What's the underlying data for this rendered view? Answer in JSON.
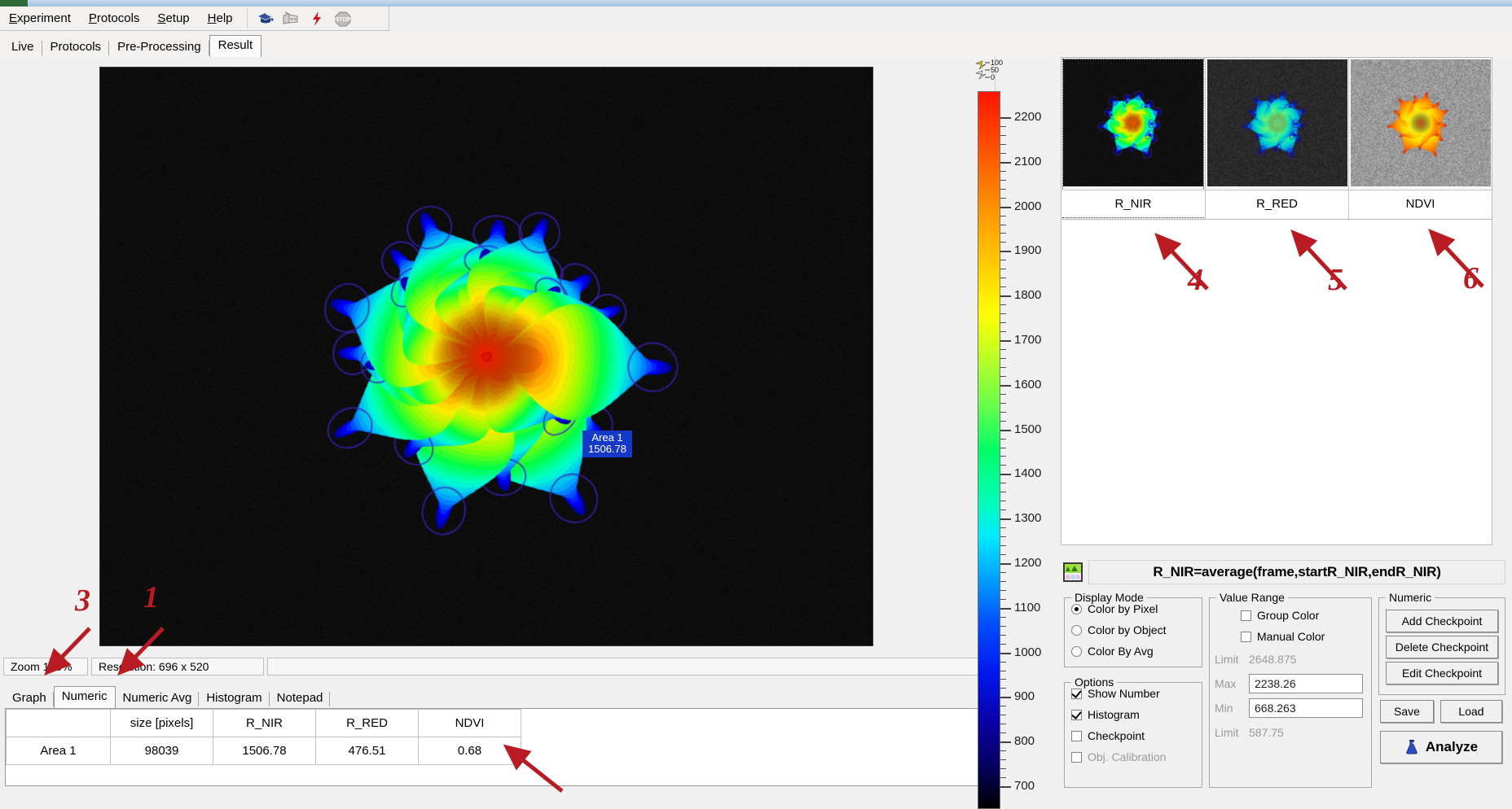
{
  "app": {
    "menu": [
      {
        "label": "Experiment",
        "accel": "E"
      },
      {
        "label": "Protocols",
        "accel": "P"
      },
      {
        "label": "Setup",
        "accel": "S"
      },
      {
        "label": "Help",
        "accel": "H"
      }
    ],
    "toolbar_icons": [
      "graduation-cap-icon",
      "camera-protocol-icon",
      "lightning-bolt-icon",
      "stop-sign-icon"
    ],
    "tabs": [
      {
        "label": "Live",
        "active": false
      },
      {
        "label": "Protocols",
        "active": false
      },
      {
        "label": "Pre-Processing",
        "active": false
      },
      {
        "label": "Result",
        "active": true
      }
    ]
  },
  "viewport": {
    "area_label": {
      "name": "Area 1",
      "value": "1506.78"
    },
    "status": {
      "zoom": "Zoom 100%",
      "resolution": "Resolution: 696 x 520",
      "blank": ""
    }
  },
  "bottom_tabs": [
    {
      "label": "Graph",
      "active": false
    },
    {
      "label": "Numeric",
      "active": true
    },
    {
      "label": "Numeric Avg",
      "active": false
    },
    {
      "label": "Histogram",
      "active": false
    },
    {
      "label": "Notepad",
      "active": false
    }
  ],
  "table": {
    "headers": [
      "",
      "size [pixels]",
      "R_NIR",
      "R_RED",
      "NDVI"
    ],
    "rows": [
      {
        "cells": [
          "Area 1",
          "98039",
          "1506.78",
          "476.51",
          "0.68"
        ]
      }
    ]
  },
  "colorbar": {
    "histogram_icon_labels": [
      "100",
      "50",
      "0"
    ],
    "tick_labels": [
      "2200",
      "2100",
      "2000",
      "1900",
      "1800",
      "1700",
      "1600",
      "1500",
      "1400",
      "1300",
      "1200",
      "1100",
      "1000",
      "900",
      "800",
      "700"
    ],
    "max": 2200,
    "min": 700
  },
  "thumbnails": [
    {
      "label": "R_NIR",
      "selected": true
    },
    {
      "label": "R_RED",
      "selected": false
    },
    {
      "label": "NDVI",
      "selected": false
    }
  ],
  "formula": {
    "icon": "color-palette-icon",
    "text": "R_NIR=average(frame,startR_NIR,endR_NIR)"
  },
  "display_mode": {
    "title": "Display Mode",
    "options": [
      {
        "label": "Color by Pixel",
        "selected": true
      },
      {
        "label": "Color by Object",
        "selected": false
      },
      {
        "label": "Color By Avg",
        "selected": false
      }
    ]
  },
  "options": {
    "title": "Options",
    "items": [
      {
        "label": "Show Number",
        "checked": true,
        "disabled": false
      },
      {
        "label": "Histogram",
        "checked": true,
        "disabled": false
      },
      {
        "label": "Checkpoint",
        "checked": false,
        "disabled": false
      },
      {
        "label": "Obj. Calibration",
        "checked": false,
        "disabled": true
      }
    ]
  },
  "value_range": {
    "title": "Value Range",
    "checkboxes": [
      {
        "label": "Group Color",
        "checked": false
      },
      {
        "label": "Manual Color",
        "checked": false
      }
    ],
    "fields": [
      {
        "label": "Limit",
        "value": "2648.875",
        "editable": false
      },
      {
        "label": "Max",
        "value": "2238.26",
        "editable": true
      },
      {
        "label": "Min",
        "value": "668.263",
        "editable": true
      },
      {
        "label": "Limit",
        "value": "587.75",
        "editable": false
      }
    ]
  },
  "numeric": {
    "title": "Numeric",
    "buttons": [
      "Add Checkpoint",
      "Delete Checkpoint",
      "Edit Checkpoint",
      "Save",
      "Load"
    ],
    "analyze_label": "Analyze"
  },
  "annotations": [
    {
      "number": "1",
      "target": "numeric-tab"
    },
    {
      "number": "3",
      "target": "graph-tab"
    },
    {
      "number": "4",
      "target": "thumbnail-r-nir"
    },
    {
      "number": "5",
      "target": "thumbnail-r-red"
    },
    {
      "number": "6",
      "target": "thumbnail-ndvi"
    }
  ],
  "colors": {
    "annotation_red": "#b81c22",
    "selection_blue": "#2a8fe0",
    "label_blue": "#1638c8"
  }
}
